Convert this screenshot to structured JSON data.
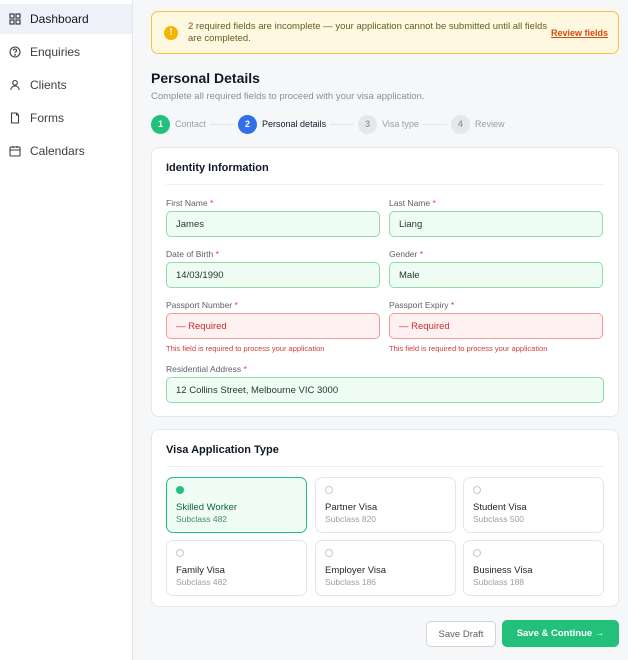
{
  "sidebar": {
    "items": [
      {
        "label": "Dashboard",
        "icon": "grid-icon",
        "active": true
      },
      {
        "label": "Enquiries",
        "icon": "help-circle-icon"
      },
      {
        "label": "Clients",
        "icon": "user-icon"
      },
      {
        "label": "Forms",
        "icon": "file-icon"
      },
      {
        "label": "Calendars",
        "icon": "calendar-icon"
      }
    ]
  },
  "alert": {
    "icon_glyph": "!",
    "message": "2 required fields are incomplete — your application cannot be submitted until all fields are completed.",
    "link": "Review fields",
    "color": "#f4c542"
  },
  "page": {
    "title": "Personal Details",
    "subtitle": "Complete all required fields to proceed with your visa application."
  },
  "steps": [
    {
      "number": "1",
      "label": "Contact",
      "state": "done"
    },
    {
      "number": "2",
      "label": "Personal details",
      "state": "current"
    },
    {
      "number": "3",
      "label": "Visa type",
      "state": "todo"
    },
    {
      "number": "4",
      "label": "Review",
      "state": "todo"
    }
  ],
  "identity": {
    "title": "Identity Information",
    "required_marker": "*",
    "fields": {
      "first_name": {
        "label": "First Name",
        "value": "James"
      },
      "last_name": {
        "label": "Last Name",
        "value": "Liang"
      },
      "dob": {
        "label": "Date of Birth",
        "value": "14/03/1990"
      },
      "gender": {
        "label": "Gender",
        "value": "Male"
      },
      "passport_number": {
        "label": "Passport Number",
        "value": "— Required",
        "error": "This field is required to process your application"
      },
      "passport_expiry": {
        "label": "Passport Expiry",
        "value": "— Required",
        "error": "This field is required to process your application"
      },
      "address": {
        "label": "Residential Address",
        "value": "12 Collins Street, Melbourne VIC 3000"
      }
    }
  },
  "visa": {
    "title": "Visa Application Type",
    "options": [
      {
        "name": "Skilled Worker",
        "subclass": "Subclass 482",
        "selected": true
      },
      {
        "name": "Partner Visa",
        "subclass": "Subclass 820"
      },
      {
        "name": "Student Visa",
        "subclass": "Subclass 500"
      },
      {
        "name": "Family Visa",
        "subclass": "Subclass 482"
      },
      {
        "name": "Employer Visa",
        "subclass": "Subclass 186"
      },
      {
        "name": "Business Visa",
        "subclass": "Subclass 188"
      }
    ]
  },
  "actions": {
    "draft": "Save Draft",
    "save": "Save & Continue →"
  },
  "colors": {
    "accent_green": "#22c07a",
    "accent_blue": "#2f6fe8",
    "error_red": "#e2383f"
  }
}
